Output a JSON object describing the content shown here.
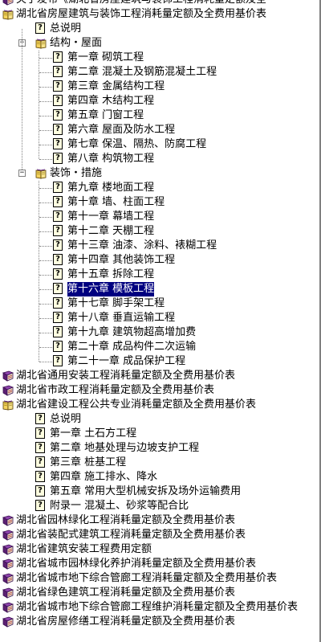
{
  "tree": {
    "items": [
      {
        "level": 0,
        "icon": "closed-book-icon",
        "label": "关于发布《湖北省房屋建筑与装饰工程消耗量定额及全"
      },
      {
        "level": 0,
        "icon": "open-book-icon",
        "label": "湖北省房屋建筑与装饰工程消耗量定额及全费用基价表"
      },
      {
        "level": 1,
        "icon": "help-topic-icon",
        "label": "总说明"
      },
      {
        "level": 1,
        "icon": "open-book-icon",
        "label": "结构・屋面",
        "expanded": true
      },
      {
        "level": 2,
        "icon": "help-topic-icon",
        "label": "第一章  砌筑工程"
      },
      {
        "level": 2,
        "icon": "help-topic-icon",
        "label": "第二章  混凝土及钢筋混凝土工程"
      },
      {
        "level": 2,
        "icon": "help-topic-icon",
        "label": "第三章  金属结构工程"
      },
      {
        "level": 2,
        "icon": "help-topic-icon",
        "label": "第四章  木结构工程"
      },
      {
        "level": 2,
        "icon": "help-topic-icon",
        "label": "第五章  门窗工程"
      },
      {
        "level": 2,
        "icon": "help-topic-icon",
        "label": "第六章  屋面及防水工程"
      },
      {
        "level": 2,
        "icon": "help-topic-icon",
        "label": "第七章  保温、隔热、防腐工程"
      },
      {
        "level": 2,
        "icon": "help-topic-icon",
        "label": "第八章  构筑物工程"
      },
      {
        "level": 1,
        "icon": "open-book-icon",
        "label": "装饰・措施",
        "expanded": true
      },
      {
        "level": 2,
        "icon": "help-topic-icon",
        "label": "第九章  楼地面工程"
      },
      {
        "level": 2,
        "icon": "help-topic-icon",
        "label": "第十章  墙、柱面工程"
      },
      {
        "level": 2,
        "icon": "help-topic-icon",
        "label": "第十一章  幕墙工程"
      },
      {
        "level": 2,
        "icon": "help-topic-icon",
        "label": "第十二章  天棚工程"
      },
      {
        "level": 2,
        "icon": "help-topic-icon",
        "label": "第十三章  油漆、涂料、裱糊工程"
      },
      {
        "level": 2,
        "icon": "help-topic-icon",
        "label": "第十四章  其他装饰工程"
      },
      {
        "level": 2,
        "icon": "help-topic-icon",
        "label": "第十五章  拆除工程"
      },
      {
        "level": 2,
        "icon": "help-topic-icon",
        "label": "第十六章  模板工程",
        "selected": true
      },
      {
        "level": 2,
        "icon": "help-topic-icon",
        "label": "第十七章  脚手架工程"
      },
      {
        "level": 2,
        "icon": "help-topic-icon",
        "label": "第十八章  垂直运输工程"
      },
      {
        "level": 2,
        "icon": "help-topic-icon",
        "label": "第十九章  建筑物超高增加费"
      },
      {
        "level": 2,
        "icon": "help-topic-icon",
        "label": "第二十章  成品构件二次运输"
      },
      {
        "level": 2,
        "icon": "help-topic-icon",
        "label": "第二十一章  成品保护工程"
      },
      {
        "level": 0,
        "icon": "closed-book-icon",
        "label": "湖北省通用安装工程消耗量定额及全费用基价表"
      },
      {
        "level": 0,
        "icon": "closed-book-icon",
        "label": "湖北省市政工程消耗量定额及全费用基价表"
      },
      {
        "level": 0,
        "icon": "open-book-icon",
        "label": "湖北省建设工程公共专业消耗量定额及全费用基价表"
      },
      {
        "level": 1,
        "icon": "help-topic-icon",
        "label": "总说明"
      },
      {
        "level": 1,
        "icon": "help-topic-icon",
        "label": "第一章  土石方工程"
      },
      {
        "level": 1,
        "icon": "help-topic-icon",
        "label": "第二章  地基处理与边坡支护工程"
      },
      {
        "level": 1,
        "icon": "help-topic-icon",
        "label": "第三章  桩基工程"
      },
      {
        "level": 1,
        "icon": "help-topic-icon",
        "label": "第四章  施工排水、降水"
      },
      {
        "level": 1,
        "icon": "help-topic-icon",
        "label": "第五章  常用大型机械安拆及场外运输费用"
      },
      {
        "level": 1,
        "icon": "help-topic-icon",
        "label": "附录一  混凝土、砂浆等配合比"
      },
      {
        "level": 0,
        "icon": "closed-book-icon",
        "label": "湖北省园林绿化工程消耗量定额及全费用基价表"
      },
      {
        "level": 0,
        "icon": "closed-book-icon",
        "label": "湖北省装配式建筑工程消耗量定额及全费用基价表"
      },
      {
        "level": 0,
        "icon": "closed-book-icon",
        "label": "湖北省建筑安装工程费用定额"
      },
      {
        "level": 0,
        "icon": "closed-book-icon",
        "label": "湖北省城市园林绿化养护消耗量定额及全费用基价表"
      },
      {
        "level": 0,
        "icon": "closed-book-icon",
        "label": "湖北省城市地下综合管廊工程消耗量定额及全费用基价表"
      },
      {
        "level": 0,
        "icon": "closed-book-icon",
        "label": "湖北省绿色建筑工程消耗量定额及全费用基价表"
      },
      {
        "level": 0,
        "icon": "closed-book-icon",
        "label": "湖北省城市地下综合管廊工程维护消耗量定额及全费用基价表"
      },
      {
        "level": 0,
        "icon": "closed-book-icon",
        "label": "湖北省房屋修缮工程消耗量定额及全费用基价表"
      }
    ]
  },
  "colors": {
    "selection_bg": "#000080",
    "book_cover": "#6b2d82",
    "book_spine": "#b33a3a",
    "open_book_pages": "#f4d35e"
  }
}
